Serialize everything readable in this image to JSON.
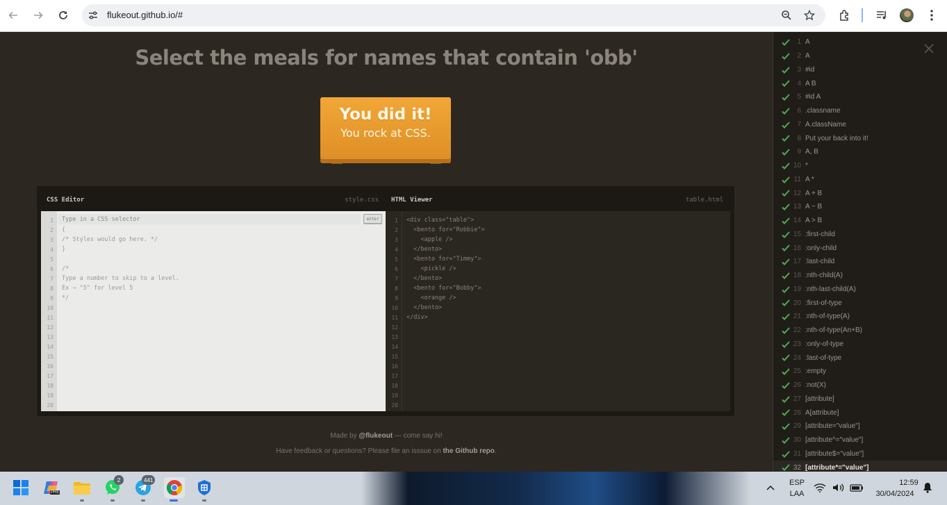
{
  "browser": {
    "url": "flukeout.github.io/#",
    "icons": [
      "back-arrow-icon",
      "forward-arrow-icon",
      "reload-icon",
      "site-settings-icon",
      "zoom-icon",
      "bookmark-star-icon",
      "extensions-icon",
      "media-control-icon",
      "profile-avatar",
      "kebab-menu-icon"
    ]
  },
  "page": {
    "level_title": "Select the meals for names that contain 'obb'",
    "done_line1": "You did it!",
    "done_line2": "You rock at CSS."
  },
  "css_editor": {
    "title": "CSS Editor",
    "file": "style.css",
    "placeholder": "Type in a CSS selector",
    "enter_label": "enter",
    "lines": [
      "{",
      "/* Styles would go here. */",
      "}",
      "",
      "/*",
      "Type a number to skip to a level.",
      "Ex → \"5\" for level 5",
      "*/"
    ],
    "line_numbers": [
      "1",
      "2",
      "3",
      "4",
      "5",
      "6",
      "7",
      "8",
      "9",
      "10",
      "11",
      "12",
      "13",
      "14",
      "15",
      "16",
      "17",
      "18",
      "19",
      "20"
    ]
  },
  "html_viewer": {
    "title": "HTML Viewer",
    "file": "table.html",
    "lines": [
      "<div class=\"table\">",
      "  <bento for=\"Robbie\">",
      "    <apple />",
      "  </bento>",
      "  <bento for=\"Timmy\">",
      "    <pickle />",
      "  </bento>",
      "  <bento for=\"Bobby\">",
      "    <orange />",
      "  </bento>",
      "</div>"
    ],
    "line_numbers": [
      "1",
      "2",
      "3",
      "4",
      "5",
      "6",
      "7",
      "8",
      "9",
      "10",
      "11",
      "12",
      "13",
      "14",
      "15",
      "16",
      "17",
      "18",
      "19",
      "20"
    ]
  },
  "footer": {
    "made_by_pre": "Made by ",
    "made_by_link": "@flukeout",
    "made_by_post": " — come say hi!",
    "feedback_pre": "Have feedback or questions? Please file an isssue on ",
    "feedback_link": "the Github repo",
    "feedback_post": "."
  },
  "levels": [
    {
      "num": "1",
      "selector": "A"
    },
    {
      "num": "2",
      "selector": "A"
    },
    {
      "num": "3",
      "selector": "#id"
    },
    {
      "num": "4",
      "selector": "A  B"
    },
    {
      "num": "5",
      "selector": "#id  A"
    },
    {
      "num": "6",
      "selector": ".classname"
    },
    {
      "num": "7",
      "selector": "A.className"
    },
    {
      "num": "8",
      "selector": "Put your back into it!"
    },
    {
      "num": "9",
      "selector": "A, B"
    },
    {
      "num": "10",
      "selector": "*"
    },
    {
      "num": "11",
      "selector": "A  *"
    },
    {
      "num": "12",
      "selector": "A + B"
    },
    {
      "num": "13",
      "selector": "A ~ B"
    },
    {
      "num": "14",
      "selector": "A > B"
    },
    {
      "num": "15",
      "selector": ":first-child"
    },
    {
      "num": "16",
      "selector": ":only-child"
    },
    {
      "num": "17",
      "selector": ":last-child"
    },
    {
      "num": "18",
      "selector": ":nth-child(A)"
    },
    {
      "num": "19",
      "selector": ":nth-last-child(A)"
    },
    {
      "num": "20",
      "selector": ":first-of-type"
    },
    {
      "num": "21",
      "selector": ":nth-of-type(A)"
    },
    {
      "num": "22",
      "selector": ":nth-of-type(An+B)"
    },
    {
      "num": "23",
      "selector": ":only-of-type"
    },
    {
      "num": "24",
      "selector": ":last-of-type"
    },
    {
      "num": "25",
      "selector": ":empty"
    },
    {
      "num": "26",
      "selector": ":not(X)"
    },
    {
      "num": "27",
      "selector": "[attribute]"
    },
    {
      "num": "28",
      "selector": "A[attribute]"
    },
    {
      "num": "29",
      "selector": "[attribute=\"value\"]"
    },
    {
      "num": "30",
      "selector": "[attribute^=\"value\"]"
    },
    {
      "num": "31",
      "selector": "[attribute$=\"value\"]"
    },
    {
      "num": "32",
      "selector": "[attribute*=\"value\"]"
    }
  ],
  "current_level": "32",
  "taskbar": {
    "whatsapp_badge": "2",
    "telegram_badge": "441",
    "lang_top": "ESP",
    "lang_bottom": "LAA",
    "time": "12:59",
    "date": "30/04/2024",
    "copilot_label": "PRE"
  },
  "colors": {
    "page_bg": "#2c2721",
    "table_orange": "#e89a2d",
    "check_green": "#4cae4c",
    "menu_bg": "#201d19"
  }
}
